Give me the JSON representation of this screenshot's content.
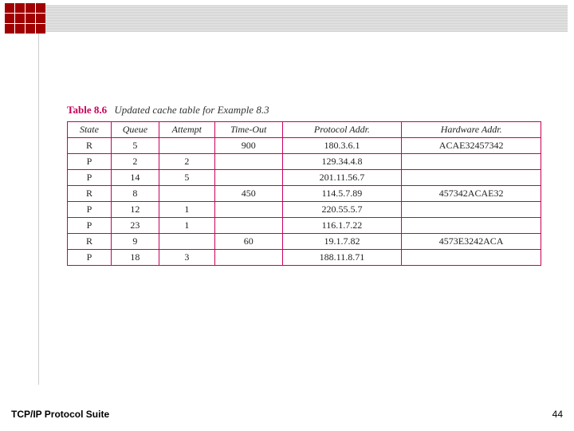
{
  "header": {
    "logo_name": "logo-grid-icon"
  },
  "caption": {
    "label": "Table 8.6",
    "title": "Updated cache table for Example 8.3"
  },
  "table": {
    "headers": {
      "state": "State",
      "queue": "Queue",
      "attempt": "Attempt",
      "timeout": "Time-Out",
      "proto": "Protocol Addr.",
      "hw": "Hardware Addr."
    },
    "rows": [
      {
        "state": "R",
        "queue": "5",
        "attempt": "",
        "timeout": "900",
        "proto": "180.3.6.1",
        "hw": "ACAE32457342"
      },
      {
        "state": "P",
        "queue": "2",
        "attempt": "2",
        "timeout": "",
        "proto": "129.34.4.8",
        "hw": ""
      },
      {
        "state": "P",
        "queue": "14",
        "attempt": "5",
        "timeout": "",
        "proto": "201.11.56.7",
        "hw": ""
      },
      {
        "state": "R",
        "queue": "8",
        "attempt": "",
        "timeout": "450",
        "proto": "114.5.7.89",
        "hw": "457342ACAE32"
      },
      {
        "state": "P",
        "queue": "12",
        "attempt": "1",
        "timeout": "",
        "proto": "220.55.5.7",
        "hw": ""
      },
      {
        "state": "P",
        "queue": "23",
        "attempt": "1",
        "timeout": "",
        "proto": "116.1.7.22",
        "hw": ""
      },
      {
        "state": "R",
        "queue": "9",
        "attempt": "",
        "timeout": "60",
        "proto": "19.1.7.82",
        "hw": "4573E3242ACA"
      },
      {
        "state": "P",
        "queue": "18",
        "attempt": "3",
        "timeout": "",
        "proto": "188.11.8.71",
        "hw": ""
      }
    ]
  },
  "footer": {
    "text": "TCP/IP Protocol Suite",
    "page": "44"
  },
  "chart_data": {
    "type": "table",
    "title": "Table 8.6 Updated cache table for Example 8.3",
    "columns": [
      "State",
      "Queue",
      "Attempt",
      "Time-Out",
      "Protocol Addr.",
      "Hardware Addr."
    ],
    "rows": [
      [
        "R",
        5,
        null,
        900,
        "180.3.6.1",
        "ACAE32457342"
      ],
      [
        "P",
        2,
        2,
        null,
        "129.34.4.8",
        null
      ],
      [
        "P",
        14,
        5,
        null,
        "201.11.56.7",
        null
      ],
      [
        "R",
        8,
        null,
        450,
        "114.5.7.89",
        "457342ACAE32"
      ],
      [
        "P",
        12,
        1,
        null,
        "220.55.5.7",
        null
      ],
      [
        "P",
        23,
        1,
        null,
        "116.1.7.22",
        null
      ],
      [
        "R",
        9,
        null,
        60,
        "19.1.7.82",
        "4573E3242ACA"
      ],
      [
        "P",
        18,
        3,
        null,
        "188.11.8.71",
        null
      ]
    ]
  }
}
